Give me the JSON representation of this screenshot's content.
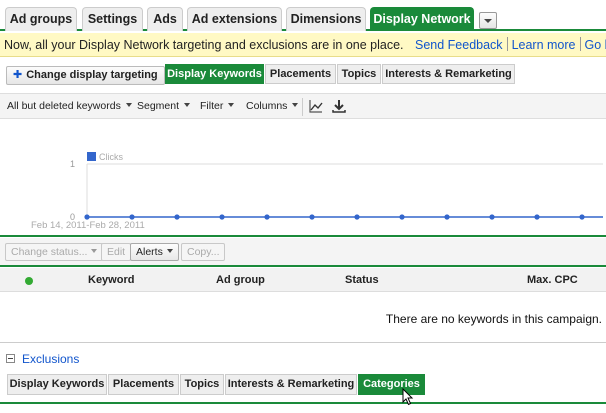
{
  "top_tabs": [
    {
      "label": "Ad groups",
      "active": false
    },
    {
      "label": "Settings",
      "active": false
    },
    {
      "label": "Ads",
      "active": false
    },
    {
      "label": "Ad extensions",
      "active": false
    },
    {
      "label": "Dimensions",
      "active": false
    },
    {
      "label": "Display Network",
      "active": true
    }
  ],
  "notice": {
    "message": "Now, all your Display Network targeting and exclusions are in one place.",
    "send_feedback": "Send Feedback",
    "learn_more": "Learn more",
    "go_back": "Go back"
  },
  "change_targeting_label": "Change display targeting",
  "sub_tabs": [
    {
      "label": "Display Keywords",
      "active": true
    },
    {
      "label": "Placements",
      "active": false
    },
    {
      "label": "Topics",
      "active": false
    },
    {
      "label": "Interests & Remarketing",
      "active": false
    }
  ],
  "toolbar": {
    "filter_keywords": "All but deleted keywords",
    "segment": "Segment",
    "filter": "Filter",
    "columns": "Columns",
    "graph_icon": "line-graph-icon",
    "download_icon": "download-icon"
  },
  "chart_data": {
    "type": "line",
    "series": [
      {
        "name": "Clicks",
        "values": [
          0,
          0,
          0,
          0,
          0,
          0,
          0,
          0,
          0,
          0,
          0,
          0
        ]
      }
    ],
    "yticks": [
      "1",
      "0"
    ],
    "ylim": [
      0,
      1
    ],
    "date_range": "Feb 14, 2011-Feb 28, 2011",
    "color": "#3366cc"
  },
  "actions": {
    "change_status": "Change status...",
    "edit": "Edit",
    "alerts": "Alerts",
    "copy": "Copy..."
  },
  "table": {
    "columns": [
      "Keyword",
      "Ad group",
      "Status",
      "Max. CPC"
    ],
    "empty_message": "There are no keywords in this campaign."
  },
  "exclusions": {
    "label": "Exclusions",
    "tabs": [
      {
        "label": "Display Keywords",
        "active": false
      },
      {
        "label": "Placements",
        "active": false
      },
      {
        "label": "Topics",
        "active": false
      },
      {
        "label": "Interests & Remarketing",
        "active": false
      },
      {
        "label": "Categories",
        "active": true
      }
    ]
  },
  "colors": {
    "accent_green": "#1a8a3a",
    "link_blue": "#1155cc",
    "notice_yellow": "#fff9c4"
  }
}
